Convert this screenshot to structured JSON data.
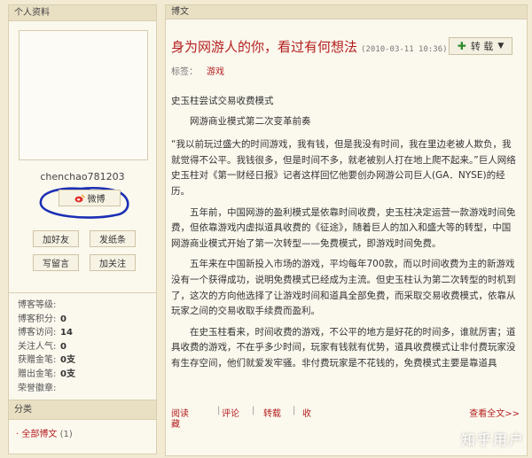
{
  "sidebar": {
    "profile_title": "个人资料",
    "username": "chenchao781203",
    "weibo_label": "微博",
    "buttons": [
      "加好友",
      "发纸条",
      "写留言",
      "加关注"
    ],
    "stats": [
      {
        "label": "博客等级:",
        "value": ""
      },
      {
        "label": "博客积分:",
        "value": "0"
      },
      {
        "label": "博客访问:",
        "value": "14"
      },
      {
        "label": "关注人气:",
        "value": "0"
      },
      {
        "label": "获赠金笔:",
        "value": "0支"
      },
      {
        "label": "赠出金笔:",
        "value": "0支"
      },
      {
        "label": "荣誉徽章:",
        "value": ""
      }
    ]
  },
  "categories": {
    "title": "分类",
    "items": [
      {
        "label": "全部博文",
        "count": "(1)"
      }
    ]
  },
  "main": {
    "header": "博文",
    "title": "身为网游人的你，看过有何想法",
    "date": "(2010-03-11 10:36)",
    "repost_label": "转 载",
    "tag_label": "标签：",
    "tag": "游戏",
    "paragraphs": {
      "p0": "史玉柱尝试交易收费模式",
      "p1": "网游商业模式第二次变革前奏",
      "p2": "“我以前玩过盛大的时间游戏，我有钱，但是我没有时间，我在里边老被人欺负，我就觉得不公平。我钱很多，但是时间不多，就老被别人打在地上爬不起来。”巨人网络史玉柱对《第一财经日报》记者这样回忆他要创办网游公司巨人(GA．NYSE)的经历。",
      "p3": "五年前，中国网游的盈利模式是依靠时间收费，史玉柱决定运营一款游戏时间免费，但依靠游戏内虚拟道具收费的《征途》，随着巨人的加入和盛大等的转型，中国网游商业模式开始了第一次转型——免费模式，即游戏时间免费。",
      "p4": "五年来在中国新投入市场的游戏，平均每年700款，而以时间收费为主的新游戏没有一个获得成功，说明免费模式已经成为主流。但史玉柱认为第二次转型的时机到了，这次的方向他选择了让游戏时间和道具全部免费，而采取交易收费模式，依靠从玩家之间的交易收取手续费而盈利。",
      "p5": "在史玉柱看来，时间收费的游戏，不公平的地方是好花的时间多，谁就厉害；道具收费的游戏，不在乎多少时间，玩家有钱就有优势，道具收费模式让非付费玩家没有生存空间，他们就爱发牢骚。非付费玩家是不花钱的，免费模式主要是靠道具"
    },
    "footer": {
      "read": "阅读",
      "read_wrap": "藏",
      "comment": "评论",
      "repost": "转载",
      "fav": "收",
      "more": "查看全文>>"
    }
  },
  "watermark": "知乎用户",
  "colors": {
    "accent": "#b31f1f",
    "background": "#f2ead2",
    "panel": "#fbf8ee",
    "annotation": "#1b2fb5"
  }
}
